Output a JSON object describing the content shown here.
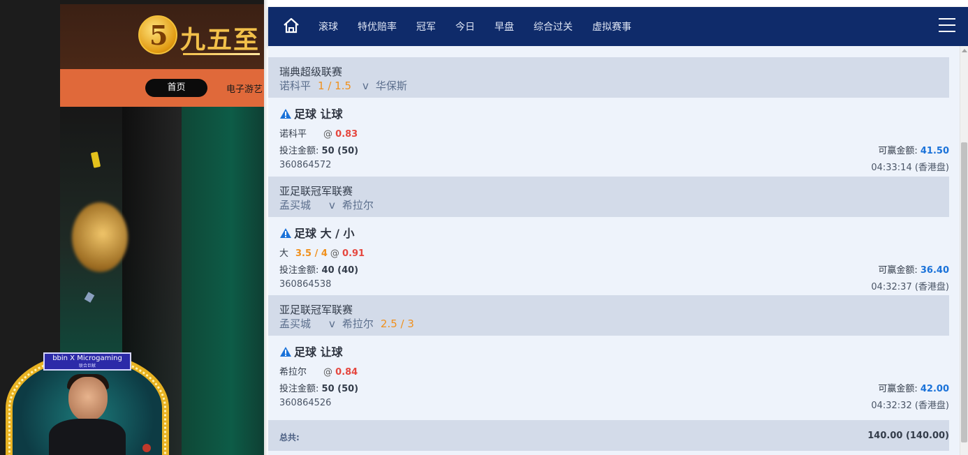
{
  "background_site": {
    "logo_digit": "5",
    "logo_text": "九五至",
    "nav_home": "首页",
    "nav_games": "电子游艺",
    "badge_brand": "bbin X Microgaming",
    "badge_brand_sub": "联合巨献"
  },
  "top_strip_text": "",
  "navbar": {
    "items": [
      "滚球",
      "特优赔率",
      "冠军",
      "今日",
      "早盘",
      "综合过关",
      "虚拟赛事"
    ]
  },
  "bets": [
    {
      "league": "瑞典超级联赛",
      "home": "诺科平",
      "handicap": "1 / 1.5",
      "vs": "v",
      "away": "华保斯",
      "away_line": "",
      "bet_type": "足球 让球",
      "selection": "诺科平",
      "selection_line": "",
      "at": "@",
      "odds": "0.83",
      "stake_label": "投注金额:",
      "stake": "50 (50)",
      "win_label": "可赢金额:",
      "win": "41.50",
      "ticket": "360864572",
      "time": "04:33:14 (香港盘)"
    },
    {
      "league": "亚足联冠军联赛",
      "home": "孟买城",
      "handicap": "",
      "vs": "v",
      "away": "希拉尔",
      "away_line": "",
      "bet_type": "足球 大 / 小",
      "selection": "大",
      "selection_line": "3.5 / 4",
      "at": "@",
      "odds": "0.91",
      "stake_label": "投注金额:",
      "stake": "40 (40)",
      "win_label": "可赢金额:",
      "win": "36.40",
      "ticket": "360864538",
      "time": "04:32:37 (香港盘)"
    },
    {
      "league": "亚足联冠军联赛",
      "home": "孟买城",
      "handicap": "",
      "vs": "v",
      "away": "希拉尔",
      "away_line": "2.5 / 3",
      "bet_type": "足球 让球",
      "selection": "希拉尔",
      "selection_line": "",
      "at": "@",
      "odds": "0.84",
      "stake_label": "投注金额:",
      "stake": "50 (50)",
      "win_label": "可赢金额:",
      "win": "42.00",
      "ticket": "360864526",
      "time": "04:32:32 (香港盘)"
    }
  ],
  "total": {
    "label": "总共:",
    "value": "140.00 (140.00)"
  },
  "colors": {
    "navbar": "#0f2b6a",
    "league_header": "#d3dbe9",
    "card": "#eef3fb",
    "odds": "#e5473f",
    "line": "#f0901c",
    "win": "#1a72d9",
    "warning_icon": "#1a72d9"
  },
  "icons": {
    "home": "home-icon",
    "menu": "hamburger-menu-icon",
    "warning": "warning-icon"
  }
}
